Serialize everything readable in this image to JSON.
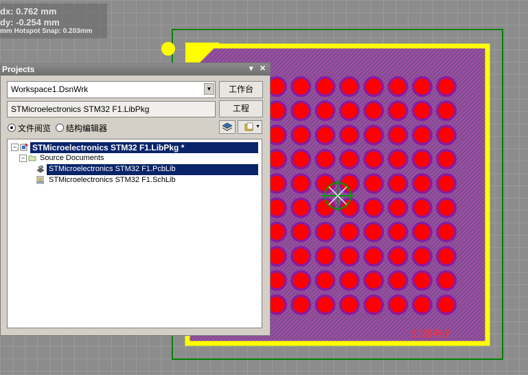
{
  "info": {
    "dx": "dx:  0.762 mm",
    "dy": "dy: -0.254 mm",
    "snap": "mm Hotspot Snap: 0.203mm"
  },
  "projects_panel": {
    "title": "Projects",
    "workspace_value": "Workspace1.DsnWrk",
    "workspace_button": "工作台",
    "project_value": "STMicroelectronics STM32 F1.LibPkg",
    "project_button": "工程",
    "view_options": [
      {
        "label": "文件阅览",
        "selected": true
      },
      {
        "label": "结构编辑器",
        "selected": false
      }
    ],
    "tree": {
      "root": "STMicroelectronics STM32 F1.LibPkg *",
      "folder": "Source Documents",
      "files": [
        {
          "name": "STMicroelectronics STM32 F1.PcbLib",
          "selected": true
        },
        {
          "name": "STMicroelectronics STM32 F1.SchLib",
          "selected": false
        }
      ]
    }
  },
  "pcb": {
    "silkscreen_text": "51黑电子",
    "pad_grid": {
      "rows": 10,
      "cols": 8
    },
    "colors": {
      "pad": "#ff0000",
      "pad_ring": "#8a1aa0",
      "body_hatch": "#a040a0",
      "outline": "#ffff00",
      "courtyard": "#008000",
      "cursor": "#00a000"
    }
  }
}
